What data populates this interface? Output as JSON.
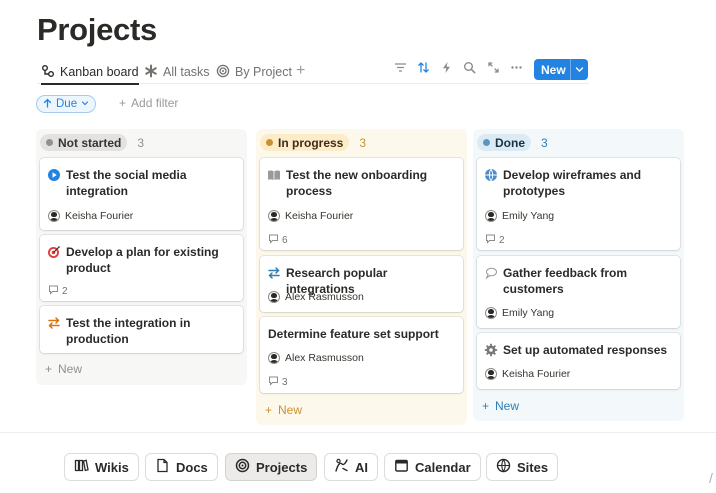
{
  "page": {
    "title": "Projects"
  },
  "views": {
    "tabs": [
      {
        "label": "Kanban board",
        "icon": "kanban-icon",
        "active": true
      },
      {
        "label": "All tasks",
        "icon": "asterisk-icon",
        "active": false
      },
      {
        "label": "By Project",
        "icon": "target-icon",
        "active": false
      }
    ],
    "add_view": "+"
  },
  "toolbar": {
    "tools": [
      "filter-icon",
      "sort-icon",
      "automation-icon",
      "search-icon",
      "expand-icon",
      "more-icon"
    ],
    "new_label": "New"
  },
  "filters": {
    "active_filter": "Due",
    "add_filter_label": "Add filter"
  },
  "board": {
    "columns": [
      {
        "name": "Not started",
        "count": "3",
        "color": "#91918e",
        "pill_bg": "#e3e2e0",
        "col_bg": "#f7f7f5",
        "accent": "#91918e",
        "new_label": "New",
        "cards": [
          {
            "title": "Test the social media integration",
            "icon": "play-circle-icon",
            "assignee": "Keisha Fourier",
            "comments": ""
          },
          {
            "title": "Develop a plan for existing product",
            "icon": "dart-target-icon",
            "assignee": "",
            "comments": "2"
          },
          {
            "title": "Test the integration in production",
            "icon": "swap-arrows-icon",
            "assignee": "",
            "comments": ""
          }
        ]
      },
      {
        "name": "In progress",
        "count": "3",
        "color": "#cb912f",
        "pill_bg": "#fdecc8",
        "col_bg": "#fcf8ec",
        "accent": "#cb912f",
        "new_label": "New",
        "cards": [
          {
            "title": "Test the new onboarding process",
            "icon": "book-icon",
            "assignee": "Keisha Fourier",
            "comments": "6"
          },
          {
            "title": "Research popular integrations",
            "icon": "swap-arrows-icon",
            "assignee": "Alex Rasmusson",
            "comments": ""
          },
          {
            "title": "Determine feature set support",
            "icon": "",
            "assignee": "Alex Rasmusson",
            "comments": "3"
          }
        ]
      },
      {
        "name": "Done",
        "count": "3",
        "color": "#5b97bd",
        "pill_bg": "#dbeaf3",
        "col_bg": "#f3f8fb",
        "accent": "#2e7eb3",
        "new_label": "New",
        "cards": [
          {
            "title": "Develop wireframes and prototypes",
            "icon": "globe-icon",
            "assignee": "Emily Yang",
            "comments": "2"
          },
          {
            "title": "Gather feedback from customers",
            "icon": "speech-bubble-icon",
            "assignee": "Emily Yang",
            "comments": ""
          },
          {
            "title": "Set up automated responses",
            "icon": "gear-icon",
            "assignee": "Keisha Fourier",
            "comments": ""
          }
        ]
      }
    ]
  },
  "bottom_nav": [
    {
      "label": "Wikis",
      "icon": "wiki-book-icon",
      "active": false
    },
    {
      "label": "Docs",
      "icon": "doc-icon",
      "active": false
    },
    {
      "label": "Projects",
      "icon": "target-icon",
      "active": true
    },
    {
      "label": "AI",
      "icon": "ai-icon",
      "active": false
    },
    {
      "label": "Calendar",
      "icon": "calendar-icon",
      "active": false
    },
    {
      "label": "Sites",
      "icon": "globe-icon",
      "active": false
    }
  ]
}
